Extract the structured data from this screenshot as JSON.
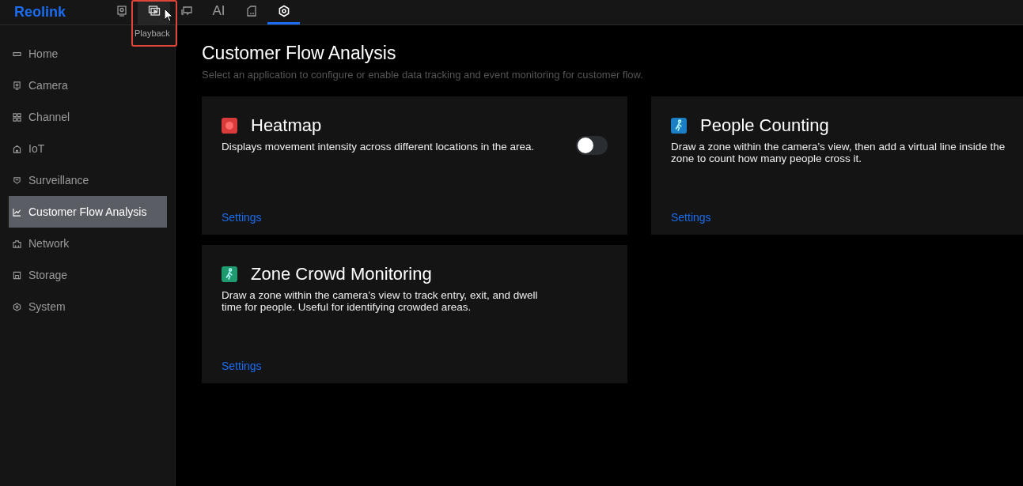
{
  "brand": "Reolink",
  "tabs": [
    {
      "kind": "icon",
      "selected": false,
      "hovered": false
    },
    {
      "kind": "icon",
      "selected": false,
      "hovered": true,
      "tooltip": "Playback"
    },
    {
      "kind": "icon",
      "selected": false,
      "hovered": false
    },
    {
      "kind": "text",
      "label": "AI",
      "selected": false,
      "hovered": false
    },
    {
      "kind": "icon",
      "selected": false,
      "hovered": false
    },
    {
      "kind": "icon",
      "selected": true,
      "hovered": false
    }
  ],
  "sidebar": {
    "items": [
      {
        "label": "Home",
        "selected": false
      },
      {
        "label": "Camera",
        "selected": false
      },
      {
        "label": "Channel",
        "selected": false
      },
      {
        "label": "IoT",
        "selected": false
      },
      {
        "label": "Surveillance",
        "selected": false
      },
      {
        "label": "Customer Flow Analysis",
        "selected": true
      },
      {
        "label": "Network",
        "selected": false
      },
      {
        "label": "Storage",
        "selected": false
      },
      {
        "label": "System",
        "selected": false
      }
    ]
  },
  "page": {
    "title": "Customer Flow Analysis",
    "subtitle": "Select an application to configure or enable data tracking and event monitoring for customer flow."
  },
  "cards": [
    {
      "title": "Heatmap",
      "color": "#d93a3a",
      "description": "Displays movement intensity across different locations in the area.",
      "toggle": {
        "on": false
      },
      "link": "Settings"
    },
    {
      "title": "People Counting",
      "color": "#1a7fc4",
      "description": "Draw a zone within the camera’s view, then add a virtual line inside the zone to count how many people cross it.",
      "link": "Settings"
    },
    {
      "title": "Zone Crowd Monitoring",
      "color": "#1e9a6e",
      "description": "Draw a zone within the camera’s view to track entry, exit, and dwell time for people. Useful for identifying crowded areas.",
      "link": "Settings"
    }
  ]
}
